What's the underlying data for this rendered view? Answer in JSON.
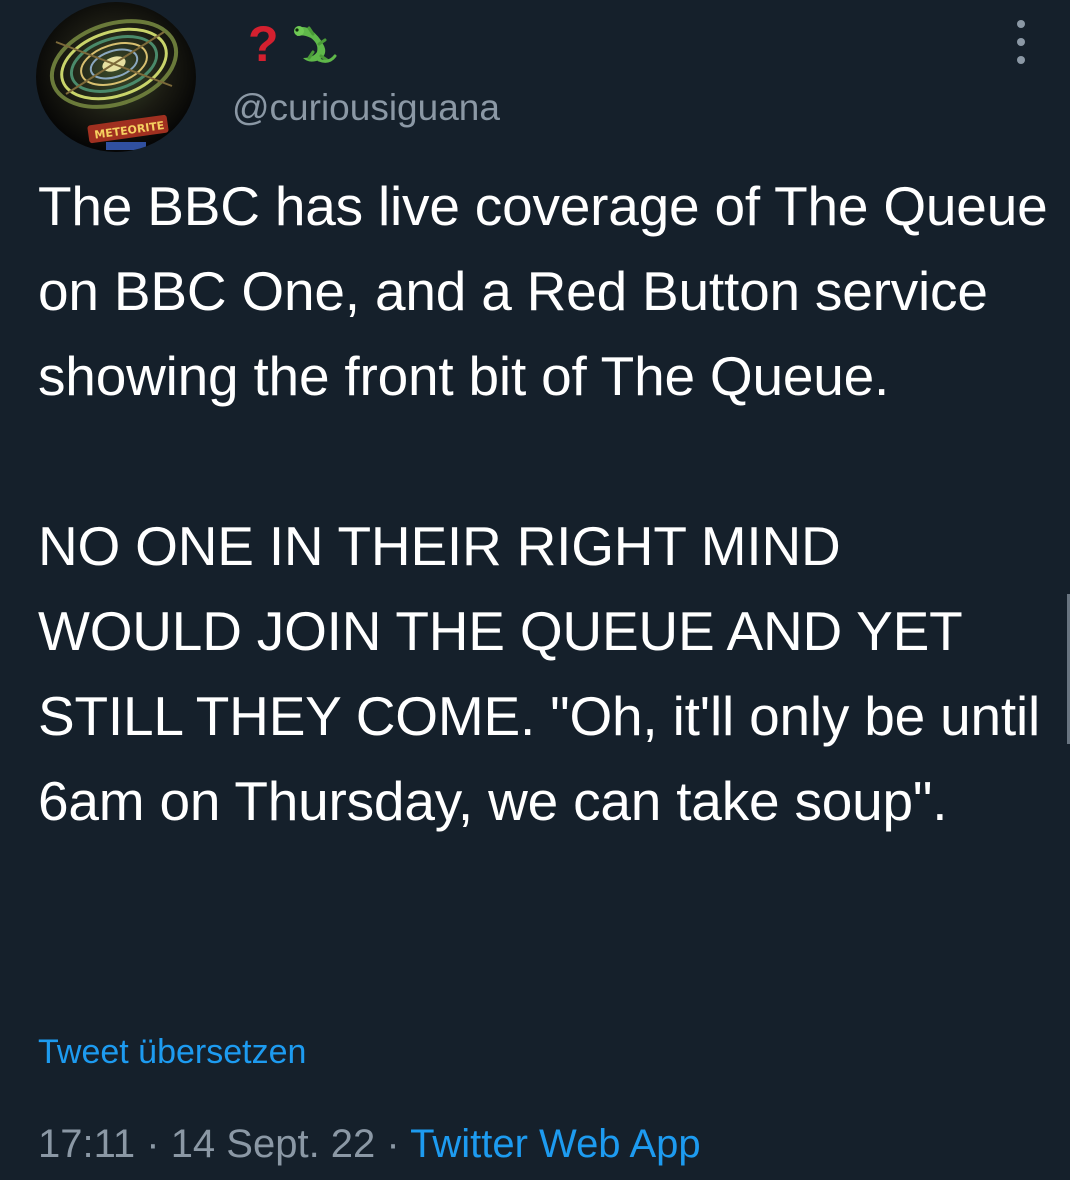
{
  "author": {
    "display_name_glyph": "?",
    "display_name_emoji": "lizard-emoji",
    "handle": "@curiousiguana",
    "avatar_sign_text": "METEORITE"
  },
  "tweet": {
    "paragraph_1": "The BBC has live coverage of The Queue on BBC One, and a Red Button service showing the front bit of The Queue.",
    "paragraph_2": "NO ONE IN THEIR RIGHT MIND WOULD JOIN THE QUEUE AND YET STILL THEY COME. \"Oh, it'll only be until 6am on Thursday, we can take soup\".",
    "translate_label": "Tweet übersetzen"
  },
  "meta": {
    "time": "17:11",
    "separator_1": " · ",
    "date": "14 Sept. 22",
    "separator_2": " · ",
    "source": "Twitter Web App"
  },
  "colors": {
    "background": "#15202b",
    "text": "#ffffff",
    "muted": "#8b98a5",
    "link": "#1d9bf0",
    "question_mark": "#d4202f"
  },
  "icons": {
    "more": "more-options-icon"
  }
}
